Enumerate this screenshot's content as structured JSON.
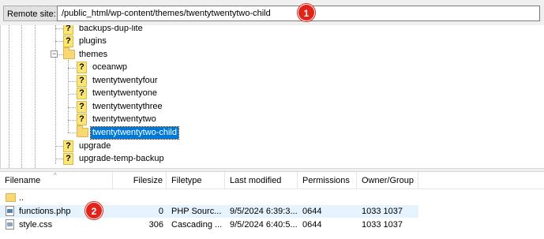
{
  "remote_site": {
    "label": "Remote site:",
    "path": "/public_html/wp-content/themes/twentytwentytwo-child"
  },
  "badges": [
    "1",
    "2"
  ],
  "tree": {
    "items": [
      {
        "label": "backups-dup-lite",
        "icon": "unknown-folder-icon"
      },
      {
        "label": "plugins",
        "icon": "unknown-folder-icon"
      },
      {
        "label": "themes",
        "icon": "folder-icon",
        "expanded": true
      },
      {
        "label": "oceanwp",
        "icon": "unknown-folder-icon"
      },
      {
        "label": "twentytwentyfour",
        "icon": "unknown-folder-icon"
      },
      {
        "label": "twentytwentyone",
        "icon": "unknown-folder-icon"
      },
      {
        "label": "twentytwentythree",
        "icon": "unknown-folder-icon"
      },
      {
        "label": "twentytwentytwo",
        "icon": "unknown-folder-icon"
      },
      {
        "label": "twentytwentytwo-child",
        "icon": "folder-icon",
        "selected": true
      },
      {
        "label": "upgrade",
        "icon": "unknown-folder-icon"
      },
      {
        "label": "upgrade-temp-backup",
        "icon": "unknown-folder-icon"
      }
    ]
  },
  "file_list": {
    "columns": [
      "Filename",
      "Filesize",
      "Filetype",
      "Last modified",
      "Permissions",
      "Owner/Group"
    ],
    "rows": [
      {
        "name": "..",
        "size": "",
        "type": "",
        "modified": "",
        "perms": "",
        "owner": "",
        "icon": "parent-folder-icon"
      },
      {
        "name": "functions.php",
        "size": "0",
        "type": "PHP Sourc...",
        "modified": "9/5/2024 6:39:3...",
        "perms": "0644",
        "owner": "1033 1037",
        "icon": "php-file-icon"
      },
      {
        "name": "style.css",
        "size": "306",
        "type": "Cascading ...",
        "modified": "9/5/2024 6:40:5...",
        "perms": "0644",
        "owner": "1033 1037",
        "icon": "css-file-icon"
      }
    ]
  },
  "colors": {
    "selection": "#0078d7",
    "badge": "#e2231a",
    "row_highlight": "#e5f3ff"
  }
}
